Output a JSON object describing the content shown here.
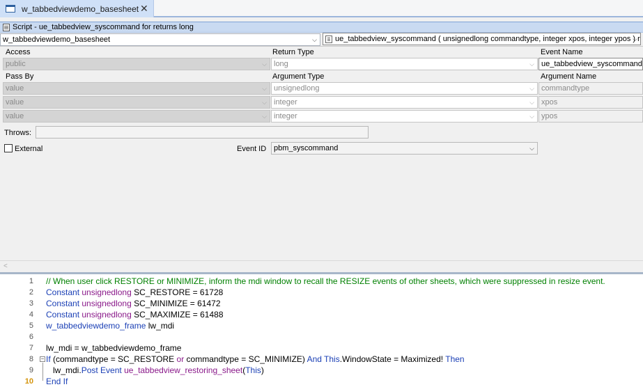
{
  "tab": {
    "title": "w_tabbedviewdemo_basesheet",
    "close_glyph": "✕"
  },
  "script_bar": {
    "title": "Script - ue_tabbedview_syscommand for  returns long"
  },
  "object_selector": {
    "value": "w_tabbedviewdemo_basesheet"
  },
  "event_selector": {
    "value": "ue_tabbedview_syscommand ( unsignedlong commandtype, integer xpos, integer ypos )  returns lo"
  },
  "prototype": {
    "access_label": "Access",
    "access_value": "public",
    "return_type_label": "Return Type",
    "return_type_value": "long",
    "event_name_label": "Event Name",
    "event_name_value": "ue_tabbedview_syscommand",
    "pass_by_label": "Pass By",
    "argument_type_label": "Argument Type",
    "argument_name_label": "Argument Name",
    "arguments": [
      {
        "pass_by": "value",
        "type": "unsignedlong",
        "name": "commandtype"
      },
      {
        "pass_by": "value",
        "type": "integer",
        "name": "xpos"
      },
      {
        "pass_by": "value",
        "type": "integer",
        "name": "ypos"
      }
    ],
    "throws_label": "Throws:",
    "throws_value": "",
    "external_label": "External",
    "event_id_label": "Event ID",
    "event_id_value": "pbm_syscommand"
  },
  "code": {
    "current_line": 10,
    "lines": [
      {
        "n": "1",
        "tokens": [
          {
            "c": "c-comment",
            "t": "// When user click RESTORE or MINIMIZE, inform the mdi window to recall the RESIZE events of other sheets, which were suppressed in resize event."
          }
        ]
      },
      {
        "n": "2",
        "tokens": [
          {
            "c": "c-kw",
            "t": "Constant "
          },
          {
            "c": "c-type",
            "t": "unsignedlong"
          },
          {
            "c": "c-plain",
            "t": " SC_RESTORE = 61728"
          }
        ]
      },
      {
        "n": "3",
        "tokens": [
          {
            "c": "c-kw",
            "t": "Constant "
          },
          {
            "c": "c-type",
            "t": "unsignedlong"
          },
          {
            "c": "c-plain",
            "t": " SC_MINIMIZE = 61472"
          }
        ]
      },
      {
        "n": "4",
        "tokens": [
          {
            "c": "c-kw",
            "t": "Constant "
          },
          {
            "c": "c-type",
            "t": "unsignedlong"
          },
          {
            "c": "c-plain",
            "t": " SC_MAXIMIZE = 61488"
          }
        ]
      },
      {
        "n": "5",
        "tokens": [
          {
            "c": "c-kw",
            "t": "w_tabbedviewdemo_frame"
          },
          {
            "c": "c-plain",
            "t": " lw_mdi"
          }
        ]
      },
      {
        "n": "6",
        "tokens": []
      },
      {
        "n": "7",
        "tokens": [
          {
            "c": "c-plain",
            "t": "lw_mdi = w_tabbedviewdemo_frame"
          }
        ]
      },
      {
        "n": "8",
        "tokens": [
          {
            "c": "c-kw",
            "t": "If"
          },
          {
            "c": "c-plain",
            "t": " (commandtype = SC_RESTORE "
          },
          {
            "c": "c-type",
            "t": "or"
          },
          {
            "c": "c-plain",
            "t": " commandtype = SC_MINIMIZE) "
          },
          {
            "c": "c-kw",
            "t": "And This"
          },
          {
            "c": "c-plain",
            "t": ".WindowState = Maximized! "
          },
          {
            "c": "c-kw",
            "t": "Then"
          }
        ]
      },
      {
        "n": "9",
        "tokens": [
          {
            "c": "c-plain",
            "t": "   lw_mdi."
          },
          {
            "c": "c-kw",
            "t": "Post Event"
          },
          {
            "c": "c-plain",
            "t": " "
          },
          {
            "c": "c-event",
            "t": "ue_tabbedview_restoring_sheet"
          },
          {
            "c": "c-plain",
            "t": "("
          },
          {
            "c": "c-kw",
            "t": "This"
          },
          {
            "c": "c-plain",
            "t": ")"
          }
        ]
      },
      {
        "n": "10",
        "tokens": [
          {
            "c": "c-kw",
            "t": "End If"
          }
        ]
      }
    ]
  },
  "colors": {
    "tab_active": "#cfe0f7",
    "script_bar": "#c9daf1",
    "keyword": "#1a3fb5",
    "comment": "#008000",
    "type": "#8a1a8a"
  },
  "icons": {
    "tab_icon": "window-icon",
    "script_icon": "script-icon",
    "event_icon": "event-icon",
    "dropdown": "chevron-down-icon"
  }
}
